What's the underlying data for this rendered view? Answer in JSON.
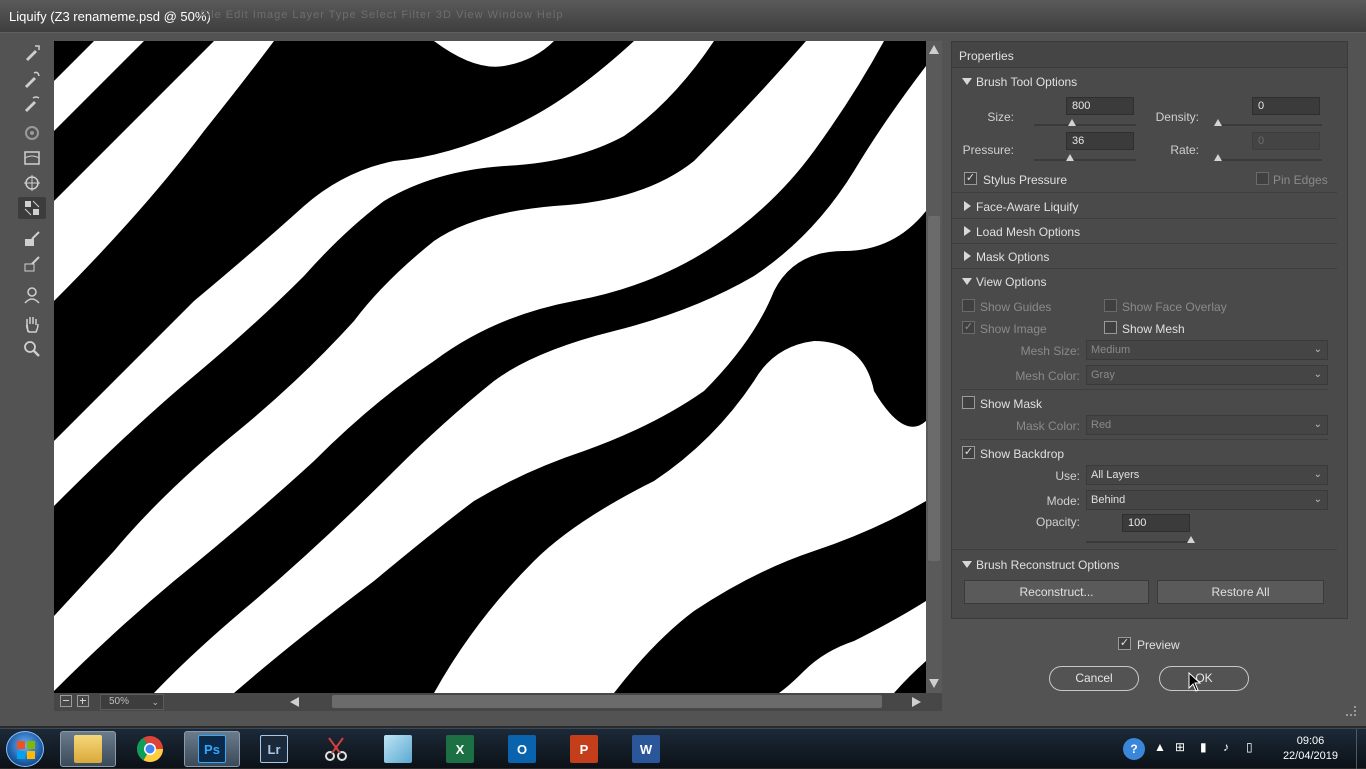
{
  "window": {
    "title": "Liquify (Z3 renameme.psd @ 50%)",
    "background_menu_ghost": "File   Edit   Image   Layer   Type   Select   Filter   3D   View   Window   Help"
  },
  "tools": [
    "forward-warp-icon",
    "reconstruct-icon",
    "smooth-icon",
    "twirl-icon",
    "pucker-icon",
    "bloat-icon",
    "push-left-icon",
    "freeze-mask-icon",
    "thaw-mask-icon",
    "face-icon",
    "hand-icon",
    "zoom-icon"
  ],
  "canvas": {
    "zoom": "50%"
  },
  "panel": {
    "title": "Properties",
    "brush_tool": {
      "header": "Brush Tool Options",
      "size_label": "Size:",
      "size": "800",
      "size_fraction": 0.38,
      "density_label": "Density:",
      "density": "0",
      "density_fraction": 0.0,
      "pressure_label": "Pressure:",
      "pressure": "36",
      "pressure_fraction": 0.36,
      "rate_label": "Rate:",
      "rate": "0",
      "rate_fraction": 0.0,
      "stylus_label": "Stylus Pressure",
      "stylus_checked": true,
      "pin_edges_label": "Pin Edges",
      "pin_edges_checked": false
    },
    "face_aware": "Face-Aware Liquify",
    "load_mesh": "Load Mesh Options",
    "mask_options": "Mask Options",
    "view_options": {
      "header": "View Options",
      "show_guides": "Show Guides",
      "show_face_overlay": "Show Face Overlay",
      "show_image": "Show Image",
      "show_mesh": "Show Mesh",
      "mesh_size_label": "Mesh Size:",
      "mesh_size": "Medium",
      "mesh_color_label": "Mesh Color:",
      "mesh_color": "Gray",
      "show_mask": "Show Mask",
      "mask_color_label": "Mask Color:",
      "mask_color": "Red",
      "show_backdrop": "Show Backdrop",
      "use_label": "Use:",
      "use": "All Layers",
      "mode_label": "Mode:",
      "mode": "Behind",
      "opacity_label": "Opacity:",
      "opacity": "100",
      "opacity_fraction": 1.0
    },
    "reconstruct": {
      "header": "Brush Reconstruct Options",
      "reconstruct_button": "Reconstruct...",
      "restore_all_button": "Restore All"
    }
  },
  "footer": {
    "preview_label": "Preview",
    "cancel": "Cancel",
    "ok": "OK"
  },
  "taskbar": {
    "apps": [
      "Windows Explorer",
      "Google Chrome",
      "Photoshop",
      "Lightroom",
      "Snipping Tool",
      "Notepad",
      "Excel",
      "Outlook",
      "PowerPoint",
      "Word"
    ],
    "ps_label": "Ps",
    "lr_label": "Lr",
    "xl_label": "X",
    "ol_label": "O",
    "pp_label": "P",
    "wd_label": "W",
    "time": "09:06",
    "date": "22/04/2019"
  },
  "colors": {
    "accent_ps": "#0b2a4a",
    "ps_text": "#31a8ff",
    "excel": "#1d7044",
    "outlook": "#0a64ad",
    "powerpoint": "#c43e1c",
    "word": "#2b579a"
  }
}
